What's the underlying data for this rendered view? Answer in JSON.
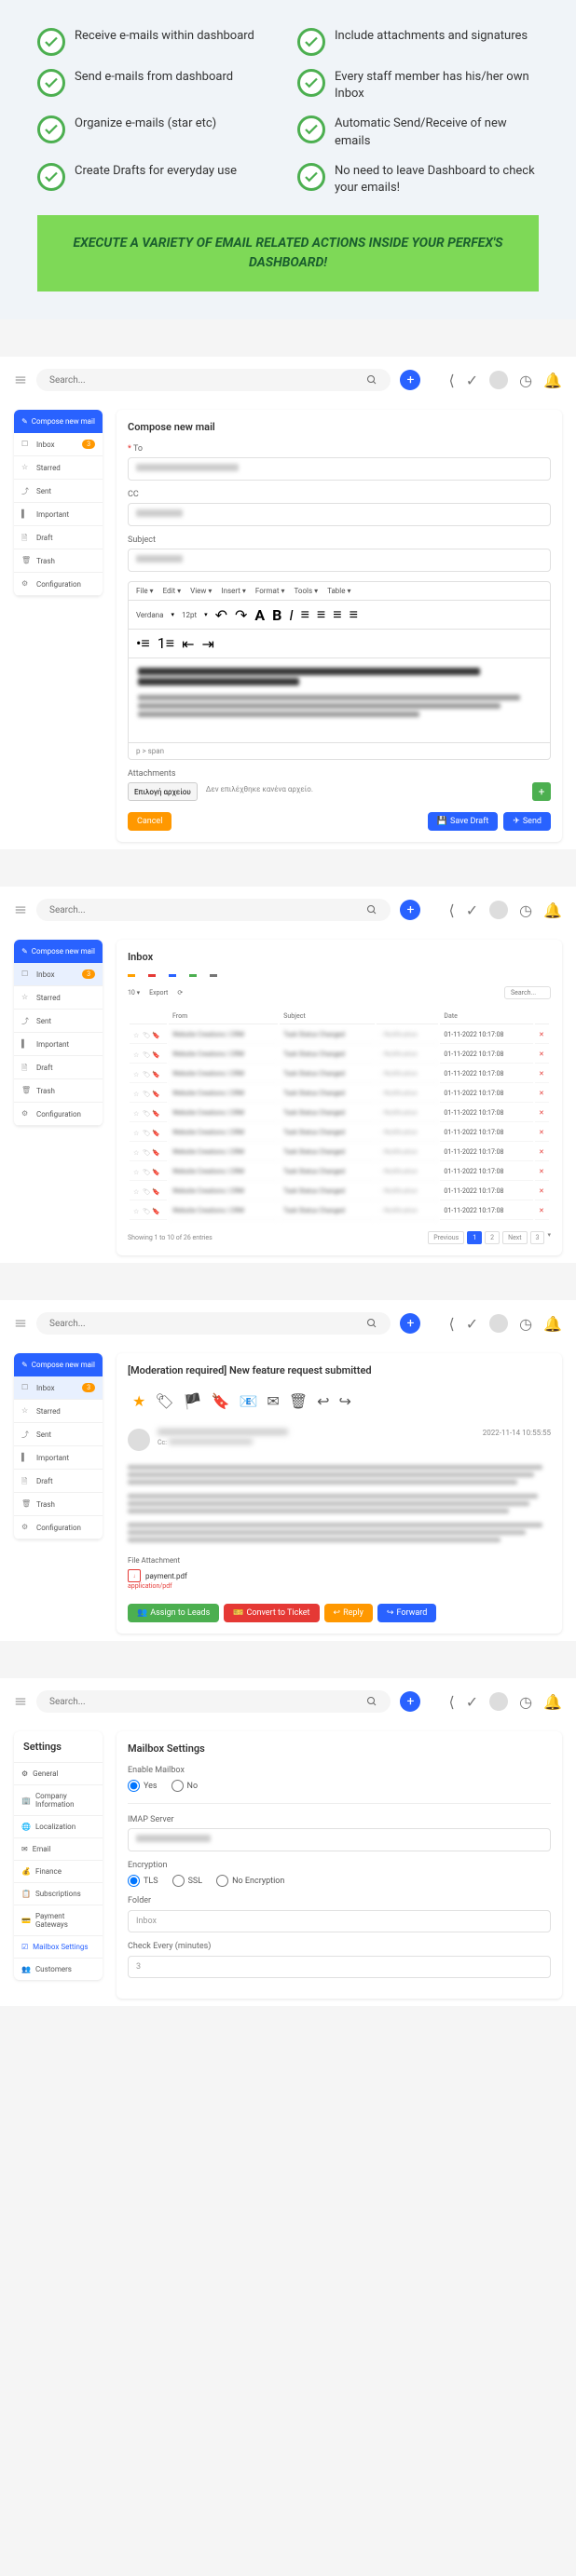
{
  "features": [
    "Receive e-mails within dashboard",
    "Include attachments and signatures",
    "Send e-mails from dashboard",
    "Every staff member has his/her own Inbox",
    "Organize e-mails (star etc)",
    "Automatic Send/Receive of new emails",
    "Create Drafts for everyday use",
    "No need to leave Dashboard to check your emails!"
  ],
  "banner": "EXECUTE A VARIETY OF EMAIL RELATED ACTIONS INSIDE YOUR PERFEX'S DASHBOARD!",
  "search_ph": "Search...",
  "sidebar": {
    "compose": "Compose new mail",
    "items": [
      {
        "label": "Inbox",
        "badge": "3"
      },
      {
        "label": "Starred"
      },
      {
        "label": "Sent"
      },
      {
        "label": "Important"
      },
      {
        "label": "Draft"
      },
      {
        "label": "Trash"
      },
      {
        "label": "Configuration"
      }
    ]
  },
  "compose": {
    "title": "Compose new mail",
    "to": "To",
    "cc": "CC",
    "subject": "Subject",
    "menus": [
      "File",
      "Edit",
      "View",
      "Insert",
      "Format",
      "Tools",
      "Table"
    ],
    "font": "Verdana",
    "size": "12pt",
    "path": "p > span",
    "attach": "Attachments",
    "filebtn": "Επιλογή αρχείου",
    "filetxt": "Δεν επιλέχθηκε κανένα αρχείο.",
    "cancel": "Cancel",
    "draft": "Save Draft",
    "send": "Send"
  },
  "inbox": {
    "title": "Inbox",
    "export": "Export",
    "cols": [
      "From",
      "Subject",
      "Date"
    ],
    "rows": [
      {
        "f": "Website Creations | CRM",
        "s": "Task Status Changed",
        "d": "01-11-2022 10:17:08"
      },
      {
        "f": "Website Creations | CRM",
        "s": "Task Status Changed",
        "d": "01-11-2022 10:17:08"
      },
      {
        "f": "Website Creations | CRM",
        "s": "Task Status Changed",
        "d": "01-11-2022 10:17:08"
      },
      {
        "f": "Website Creations | CRM",
        "s": "Task Status Changed",
        "d": "01-11-2022 10:17:08"
      },
      {
        "f": "Website Creations | CRM",
        "s": "Task Status Changed",
        "d": "01-11-2022 10:17:08"
      },
      {
        "f": "Website Creations | CRM",
        "s": "Task Status Changed",
        "d": "01-11-2022 10:17:08"
      },
      {
        "f": "Website Creations | CRM",
        "s": "Task Status Changed",
        "d": "01-11-2022 10:17:08"
      },
      {
        "f": "Website Creations | CRM",
        "s": "Task Status Changed",
        "d": "01-11-2022 10:17:08"
      },
      {
        "f": "Website Creations | CRM",
        "s": "Task Status Changed",
        "d": "01-11-2022 10:17:08"
      },
      {
        "f": "Website Creations | CRM",
        "s": "Task Status Changed",
        "d": "01-11-2022 10:17:08"
      }
    ],
    "showing": "Showing 1 to 10 of 26 entries",
    "prev": "Previous",
    "next": "Next",
    "search_ph": "Search..."
  },
  "view": {
    "title": "[Moderation required] New feature request submitted",
    "cc": "Cc:",
    "date": "2022-11-14 10:55:55",
    "fileatt": "File Attachment",
    "pdf": "payment.pdf",
    "pdftype": "application/pdf",
    "assign": "Assign to Leads",
    "convert": "Convert to Ticket",
    "reply": "Reply",
    "forward": "Forward"
  },
  "settings": {
    "title": "Settings",
    "items": [
      "General",
      "Company Information",
      "Localization",
      "Email",
      "Finance",
      "Subscriptions",
      "Payment Gateways",
      "Mailbox Settings",
      "Customers"
    ],
    "main_title": "Mailbox Settings",
    "enable": "Enable Mailbox",
    "yes": "Yes",
    "no": "No",
    "imap": "IMAP Server",
    "enc": "Encryption",
    "tls": "TLS",
    "ssl": "SSL",
    "noenc": "No Encryption",
    "folder": "Folder",
    "folder_val": "Inbox",
    "check": "Check Every (minutes)",
    "check_val": "3"
  }
}
